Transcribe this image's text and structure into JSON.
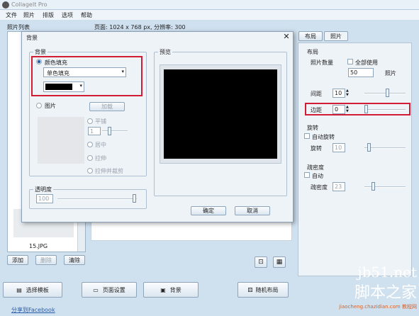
{
  "app": {
    "title": "CollageIt Pro"
  },
  "menu": [
    "文件",
    "照片",
    "排版",
    "选项",
    "帮助"
  ],
  "left": {
    "panel_title": "照片列表",
    "file_name": "15.JPG",
    "add": "添加",
    "delete": "删除",
    "clear": "清除",
    "share": "分享到Facebook"
  },
  "page_info": "页面: 1024 x 768 px, 分辨率: 300",
  "right": {
    "tabs": [
      "布局",
      "照片"
    ],
    "layout_title": "布局",
    "photo_count_label": "照片数量",
    "use_all_label": "全部使用",
    "photo_count": "50",
    "photos_unit": "照片",
    "spacing_label": "间距",
    "spacing": "10",
    "margin_label": "边距",
    "margin": "0",
    "rotate_title": "旋转",
    "auto_rotate": "自动旋转",
    "rotate_label": "旋转",
    "rotate": "10",
    "density_title": "疏密度",
    "auto": "自动",
    "density_label": "疏密度",
    "density": "23"
  },
  "bottom": {
    "template": "选择模板",
    "page_setup": "页面设置",
    "background": "背景",
    "random": "随机布局"
  },
  "dialog": {
    "title": "背景",
    "bg_group": "背景",
    "color_fill": "颜色填充",
    "fill_type": "单色填充",
    "color": "#000000",
    "picture": "图片",
    "load": "加载",
    "tile": "平铺",
    "tile_count": "1",
    "center": "居中",
    "stretch": "拉伸",
    "stretch_crop": "拉伸并裁剪",
    "opacity_group": "透明度",
    "opacity": "100",
    "preview_group": "预览",
    "ok": "确定",
    "cancel": "取消"
  },
  "watermark": {
    "line1": "jb51.net",
    "line2": "脚本之家",
    "line3": "jiaocheng.chazidian.com",
    "line4": "教程网"
  }
}
